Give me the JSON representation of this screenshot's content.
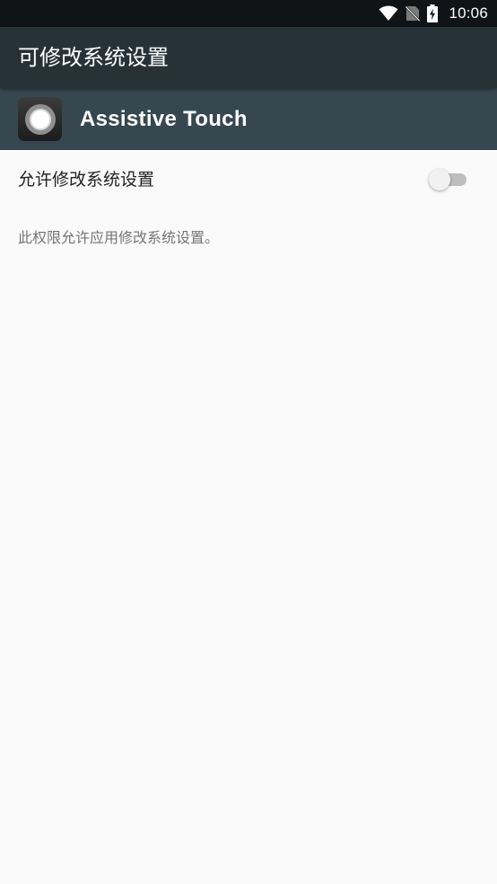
{
  "status_bar": {
    "time": "10:06",
    "icons": [
      "wifi-icon",
      "no-sim-icon",
      "battery-charging-icon"
    ]
  },
  "app_bar": {
    "title": "可修改系统设置"
  },
  "app_header": {
    "app_name": "Assistive Touch",
    "icon": "assistive-touch-app-icon"
  },
  "setting": {
    "label": "允许修改系统设置",
    "enabled": false
  },
  "description": "此权限允许应用修改系统设置。",
  "colors": {
    "status_bar": "#111416",
    "app_bar": "#263238",
    "app_header": "#37474f",
    "background": "#fafafa",
    "toggle_track_off": "#bdbdbd",
    "toggle_thumb_off": "#f1f1f1"
  }
}
